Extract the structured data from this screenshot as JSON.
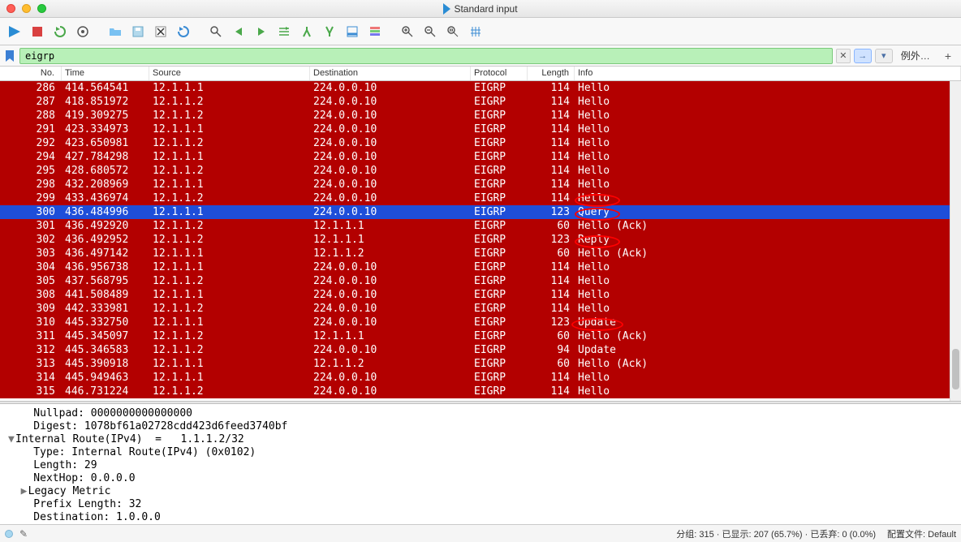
{
  "window": {
    "title": "Standard input"
  },
  "filter": {
    "value": "eigrp",
    "extra_label": "例外…"
  },
  "columns": {
    "no": "No.",
    "time": "Time",
    "source": "Source",
    "dest": "Destination",
    "proto": "Protocol",
    "len": "Length",
    "info": "Info"
  },
  "packets": [
    {
      "no": "286",
      "time": "414.564541",
      "src": "12.1.1.1",
      "dst": "224.0.0.10",
      "proto": "EIGRP",
      "len": "114",
      "info": "Hello",
      "sel": false
    },
    {
      "no": "287",
      "time": "418.851972",
      "src": "12.1.1.2",
      "dst": "224.0.0.10",
      "proto": "EIGRP",
      "len": "114",
      "info": "Hello",
      "sel": false
    },
    {
      "no": "288",
      "time": "419.309275",
      "src": "12.1.1.2",
      "dst": "224.0.0.10",
      "proto": "EIGRP",
      "len": "114",
      "info": "Hello",
      "sel": false
    },
    {
      "no": "291",
      "time": "423.334973",
      "src": "12.1.1.1",
      "dst": "224.0.0.10",
      "proto": "EIGRP",
      "len": "114",
      "info": "Hello",
      "sel": false
    },
    {
      "no": "292",
      "time": "423.650981",
      "src": "12.1.1.2",
      "dst": "224.0.0.10",
      "proto": "EIGRP",
      "len": "114",
      "info": "Hello",
      "sel": false
    },
    {
      "no": "294",
      "time": "427.784298",
      "src": "12.1.1.1",
      "dst": "224.0.0.10",
      "proto": "EIGRP",
      "len": "114",
      "info": "Hello",
      "sel": false
    },
    {
      "no": "295",
      "time": "428.680572",
      "src": "12.1.1.2",
      "dst": "224.0.0.10",
      "proto": "EIGRP",
      "len": "114",
      "info": "Hello",
      "sel": false
    },
    {
      "no": "298",
      "time": "432.208969",
      "src": "12.1.1.1",
      "dst": "224.0.0.10",
      "proto": "EIGRP",
      "len": "114",
      "info": "Hello",
      "sel": false
    },
    {
      "no": "299",
      "time": "433.436974",
      "src": "12.1.1.2",
      "dst": "224.0.0.10",
      "proto": "EIGRP",
      "len": "114",
      "info": "Hello",
      "sel": false
    },
    {
      "no": "300",
      "time": "436.484996",
      "src": "12.1.1.1",
      "dst": "224.0.0.10",
      "proto": "EIGRP",
      "len": "123",
      "info": "Query",
      "sel": true
    },
    {
      "no": "301",
      "time": "436.492920",
      "src": "12.1.1.2",
      "dst": "12.1.1.1",
      "proto": "EIGRP",
      "len": "60",
      "info": "Hello (Ack)",
      "sel": false
    },
    {
      "no": "302",
      "time": "436.492952",
      "src": "12.1.1.2",
      "dst": "12.1.1.1",
      "proto": "EIGRP",
      "len": "123",
      "info": "Reply",
      "sel": false
    },
    {
      "no": "303",
      "time": "436.497142",
      "src": "12.1.1.1",
      "dst": "12.1.1.2",
      "proto": "EIGRP",
      "len": "60",
      "info": "Hello (Ack)",
      "sel": false
    },
    {
      "no": "304",
      "time": "436.956738",
      "src": "12.1.1.1",
      "dst": "224.0.0.10",
      "proto": "EIGRP",
      "len": "114",
      "info": "Hello",
      "sel": false
    },
    {
      "no": "305",
      "time": "437.568795",
      "src": "12.1.1.2",
      "dst": "224.0.0.10",
      "proto": "EIGRP",
      "len": "114",
      "info": "Hello",
      "sel": false
    },
    {
      "no": "308",
      "time": "441.508489",
      "src": "12.1.1.1",
      "dst": "224.0.0.10",
      "proto": "EIGRP",
      "len": "114",
      "info": "Hello",
      "sel": false
    },
    {
      "no": "309",
      "time": "442.333981",
      "src": "12.1.1.2",
      "dst": "224.0.0.10",
      "proto": "EIGRP",
      "len": "114",
      "info": "Hello",
      "sel": false
    },
    {
      "no": "310",
      "time": "445.332750",
      "src": "12.1.1.1",
      "dst": "224.0.0.10",
      "proto": "EIGRP",
      "len": "123",
      "info": "Update",
      "sel": false
    },
    {
      "no": "311",
      "time": "445.345097",
      "src": "12.1.1.2",
      "dst": "12.1.1.1",
      "proto": "EIGRP",
      "len": "60",
      "info": "Hello (Ack)",
      "sel": false
    },
    {
      "no": "312",
      "time": "445.346583",
      "src": "12.1.1.2",
      "dst": "224.0.0.10",
      "proto": "EIGRP",
      "len": "94",
      "info": "Update",
      "sel": false
    },
    {
      "no": "313",
      "time": "445.390918",
      "src": "12.1.1.1",
      "dst": "12.1.1.2",
      "proto": "EIGRP",
      "len": "60",
      "info": "Hello (Ack)",
      "sel": false
    },
    {
      "no": "314",
      "time": "445.949463",
      "src": "12.1.1.1",
      "dst": "224.0.0.10",
      "proto": "EIGRP",
      "len": "114",
      "info": "Hello",
      "sel": false
    },
    {
      "no": "315",
      "time": "446.731224",
      "src": "12.1.1.2",
      "dst": "224.0.0.10",
      "proto": "EIGRP",
      "len": "114",
      "info": "Hello",
      "sel": false
    }
  ],
  "details": {
    "l0": "    Nullpad: 0000000000000000",
    "l1": "    Digest: 1078bf61a02728cdd423d6feed3740bf",
    "l2": "Internal Route(IPv4)  =   1.1.1.2/32",
    "l3": "    Type: Internal Route(IPv4) (0x0102)",
    "l4": "    Length: 29",
    "l5": "    NextHop: 0.0.0.0",
    "l6": "Legacy Metric",
    "l7": "    Prefix Length: 32",
    "l8": "    Destination: 1.0.0.0"
  },
  "status": {
    "packets": "分组: 315 · 已显示: 207 (65.7%) · 已丢弃: 0 (0.0%)",
    "profile": "配置文件: Default"
  },
  "icons": {
    "tb": [
      "fin",
      "stop",
      "restart",
      "options",
      "open",
      "save",
      "close",
      "reload",
      "find",
      "back",
      "forward",
      "jump",
      "first",
      "last",
      "autoscroll",
      "colorize",
      "zoom-in",
      "zoom-out",
      "zoom-reset",
      "columns"
    ]
  }
}
